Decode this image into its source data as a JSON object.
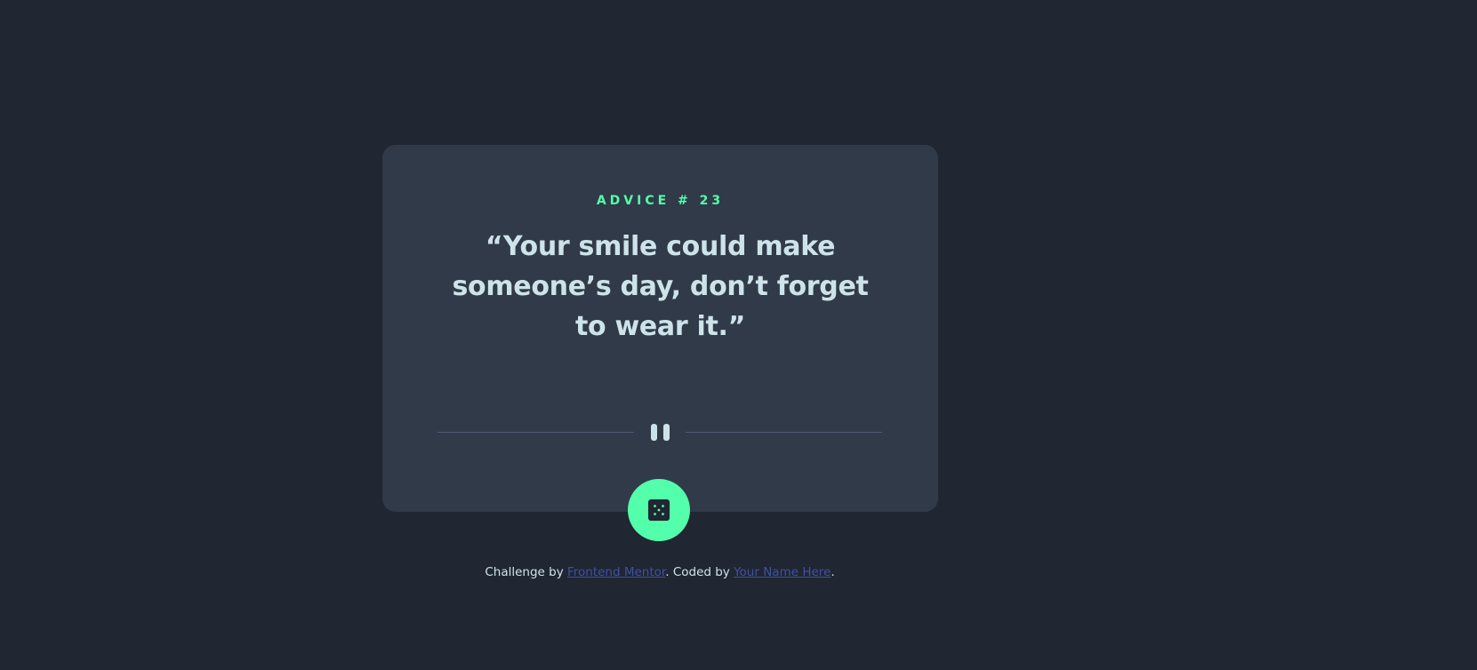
{
  "card": {
    "advice_label": "ADVICE # 23",
    "quote": "“Your smile could make someone’s day, don’t forget to wear it.”"
  },
  "divider": {
    "icon": "pause-icon"
  },
  "dice_button": {
    "icon": "dice-icon"
  },
  "footer": {
    "prefix": "Challenge by",
    "link1": "Frontend Mentor",
    "middle": ". Coded by",
    "link2": "Your Name Here",
    "suffix": "."
  },
  "colors": {
    "background": "#202632",
    "card": "#313a48",
    "accent": "#53ffaa",
    "quote_text": "#cee3e9",
    "divider": "#4f5d74",
    "link": "#3e52a3"
  }
}
